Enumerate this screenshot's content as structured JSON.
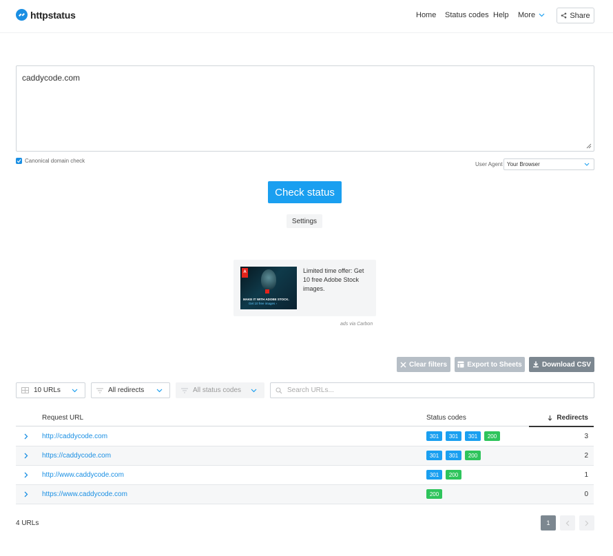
{
  "header": {
    "logo_text": "httpstatus",
    "nav": {
      "home": "Home",
      "status_codes": "Status codes",
      "help": "Help",
      "more": "More"
    },
    "share_label": "Share"
  },
  "form": {
    "urls_value": "caddycode.com",
    "canonical_label": "Canonical domain check",
    "user_agent_label": "User Agent",
    "user_agent_value": "Your Browser",
    "check_button": "Check status",
    "settings_button": "Settings"
  },
  "ad": {
    "text": "Limited time offer: Get 10 free Adobe Stock images.",
    "image_caption_1": "MAKE IT WITH ADOBE STOCK.",
    "image_caption_2": "Get 10 free images ›",
    "logo_letter": "A",
    "via": "ads via Carbon"
  },
  "actions": {
    "clear_filters": "Clear filters",
    "export_sheets": "Export to Sheets",
    "download_csv": "Download CSV"
  },
  "filters": {
    "urls": "10 URLs",
    "redirects": "All redirects",
    "status_codes": "All status codes",
    "search_placeholder": "Search URLs..."
  },
  "table": {
    "headers": {
      "request_url": "Request URL",
      "status_codes": "Status codes",
      "redirects": "Redirects"
    },
    "rows": [
      {
        "url": "http://caddycode.com",
        "codes": [
          "301",
          "301",
          "301",
          "200"
        ],
        "redirects": "3"
      },
      {
        "url": "https://caddycode.com",
        "codes": [
          "301",
          "301",
          "200"
        ],
        "redirects": "2"
      },
      {
        "url": "http://www.caddycode.com",
        "codes": [
          "301",
          "200"
        ],
        "redirects": "1"
      },
      {
        "url": "https://www.caddycode.com",
        "codes": [
          "200"
        ],
        "redirects": "0"
      }
    ]
  },
  "footer": {
    "count": "4 URLs",
    "page": "1"
  },
  "colors": {
    "accent": "#1a9ff0",
    "code_301": "#1a9ff0",
    "code_200": "#2ec45c"
  }
}
